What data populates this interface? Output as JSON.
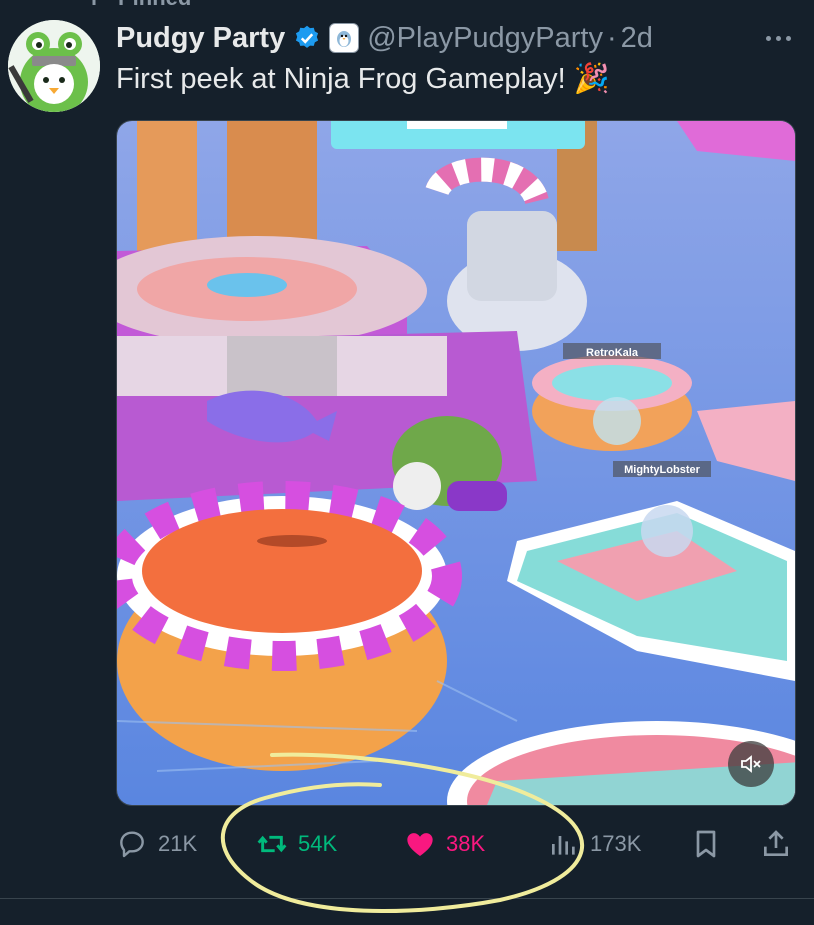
{
  "pinned": {
    "label": "Pinned"
  },
  "author": {
    "display_name": "Pudgy Party",
    "handle": "@PlayPudgyParty",
    "separator": "·",
    "time": "2d"
  },
  "tweet": {
    "text": "First peek at Ninja Frog Gameplay!",
    "emoji": "🎉"
  },
  "media": {
    "type": "video",
    "player_labels": [
      "RetroKala",
      "MightyLobster"
    ],
    "muted": true
  },
  "actions": {
    "replies": "21K",
    "retweets": "54K",
    "likes": "38K",
    "views": "173K"
  },
  "colors": {
    "background": "#15202b",
    "retweet": "#00ba7c",
    "like": "#f91880",
    "muted_text": "#8b98a5",
    "verified": "#1d9bf0",
    "annotation": "#f0ec9c"
  }
}
